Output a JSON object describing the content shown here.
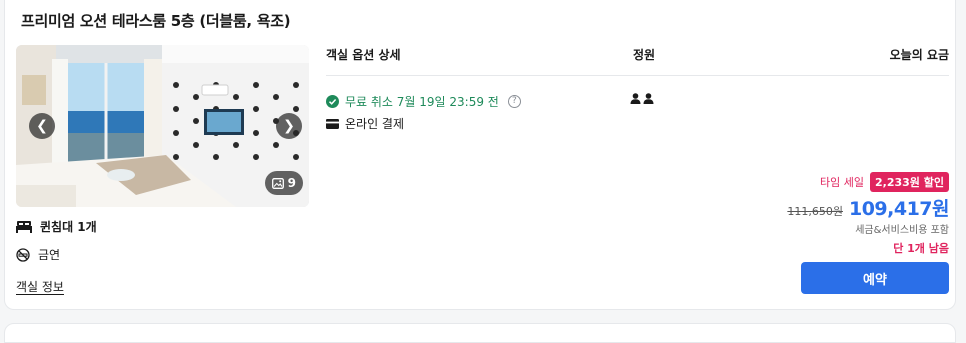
{
  "room": {
    "title": "프리미엄 오션 테라스룸 5층 (더블룸, 욕조)",
    "photo_count": "9",
    "features": {
      "bed": "퀸침대 1개",
      "smoking": "금연"
    },
    "info_link": "객실 정보"
  },
  "table": {
    "header_option": "객실 옵션 상세",
    "header_capacity": "정원",
    "header_price": "오늘의 요금"
  },
  "option": {
    "cancel_text": "무료 취소 7월 19일 23:59 전",
    "payment_text": "온라인 결제",
    "capacity_people": 2
  },
  "pricing": {
    "sale_label": "타임 세일",
    "discount_badge": "2,233원 할인",
    "original_price": "111,650원",
    "final_price": "109,417원",
    "tax_note": "세금&서비스비용 포함",
    "remaining": "단 1개 남음"
  },
  "actions": {
    "book_label": "예약"
  },
  "icons": {
    "prev": "chevron-left-icon",
    "next": "chevron-right-icon",
    "gallery": "gallery-icon",
    "bed": "bed-icon",
    "no_smoking": "no-smoking-icon",
    "check": "check-circle-icon",
    "card": "credit-card-icon",
    "help": "question-icon",
    "person": "person-icon"
  },
  "colors": {
    "accent": "#2b6fe8",
    "sale": "#e0245e",
    "free_cancel": "#1e8a5a"
  }
}
